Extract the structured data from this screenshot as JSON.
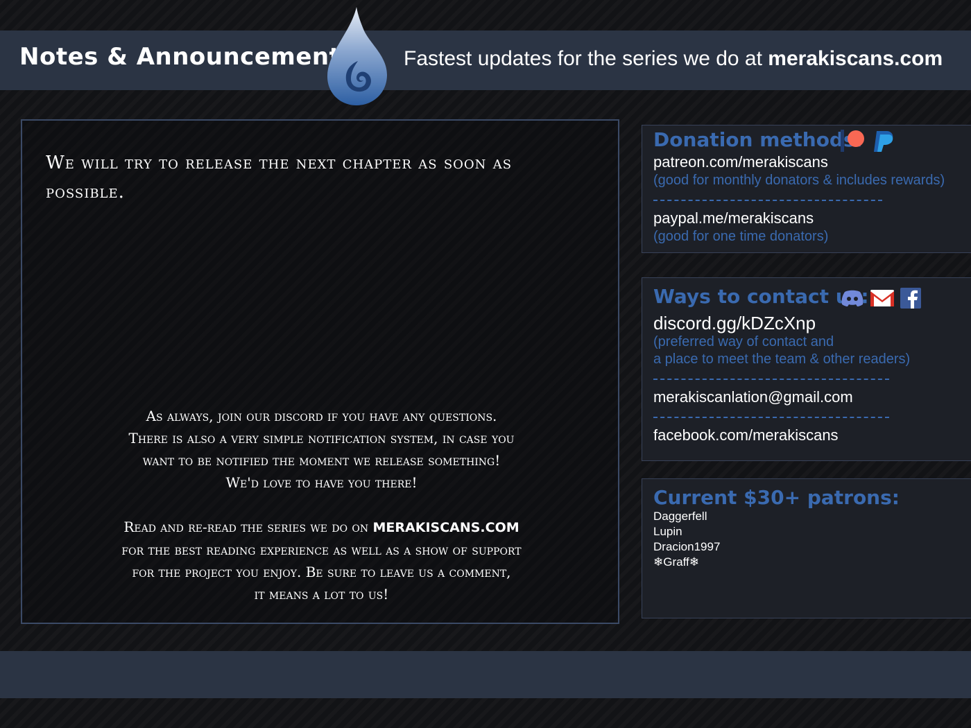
{
  "header": {
    "title": "Notes & Announcements",
    "tagline_prefix": "Fastest updates for the series we do at",
    "tagline_site": "merakiscans.com"
  },
  "notes": {
    "heading": "We will try to release the next chapter as soon as possible.",
    "para1": [
      "As always, join our discord if you have any questions.",
      "There is also a very simple notification system, in case you",
      "want to be notified the moment we release something!",
      "We'd love to have you there!"
    ],
    "para2_line1_prefix": "Read and re-read the series we do on",
    "para2_line1_site": "MERAKISCANS.COM",
    "para2_rest": [
      "for the best reading experience as well as a show of support",
      "for the project you enjoy. Be sure to leave us a comment,",
      "it means a lot to us!"
    ]
  },
  "donation": {
    "heading": "Donation methods:",
    "patreon_link": "patreon.com/merakiscans",
    "patreon_note": "(good for monthly donators & includes rewards)",
    "paypal_link": "paypal.me/merakiscans",
    "paypal_note": "(good for one time donators)",
    "icons": [
      "patreon-icon",
      "paypal-icon"
    ]
  },
  "contact": {
    "heading": "Ways to contact us:",
    "discord_link": "discord.gg/kDZcXnp",
    "discord_note_line1": "(preferred way of contact and",
    "discord_note_line2": "a place to meet the team & other readers)",
    "email": "merakiscanlation@gmail.com",
    "facebook": "facebook.com/merakiscans",
    "icons": [
      "discord-icon",
      "gmail-icon",
      "facebook-icon"
    ]
  },
  "patrons": {
    "heading": "Current $30+ patrons:",
    "names": [
      "Daggerfell",
      "Lupin",
      "Dracion1997",
      "❄Graff❄"
    ]
  },
  "colors": {
    "accent_blue": "#3a6ab0",
    "band": "#2b3444",
    "background": "#121316",
    "patreon_red": "#f96854",
    "paypal_blue": "#1e88d6",
    "discord": "#7289da",
    "facebook": "#3b5998"
  }
}
